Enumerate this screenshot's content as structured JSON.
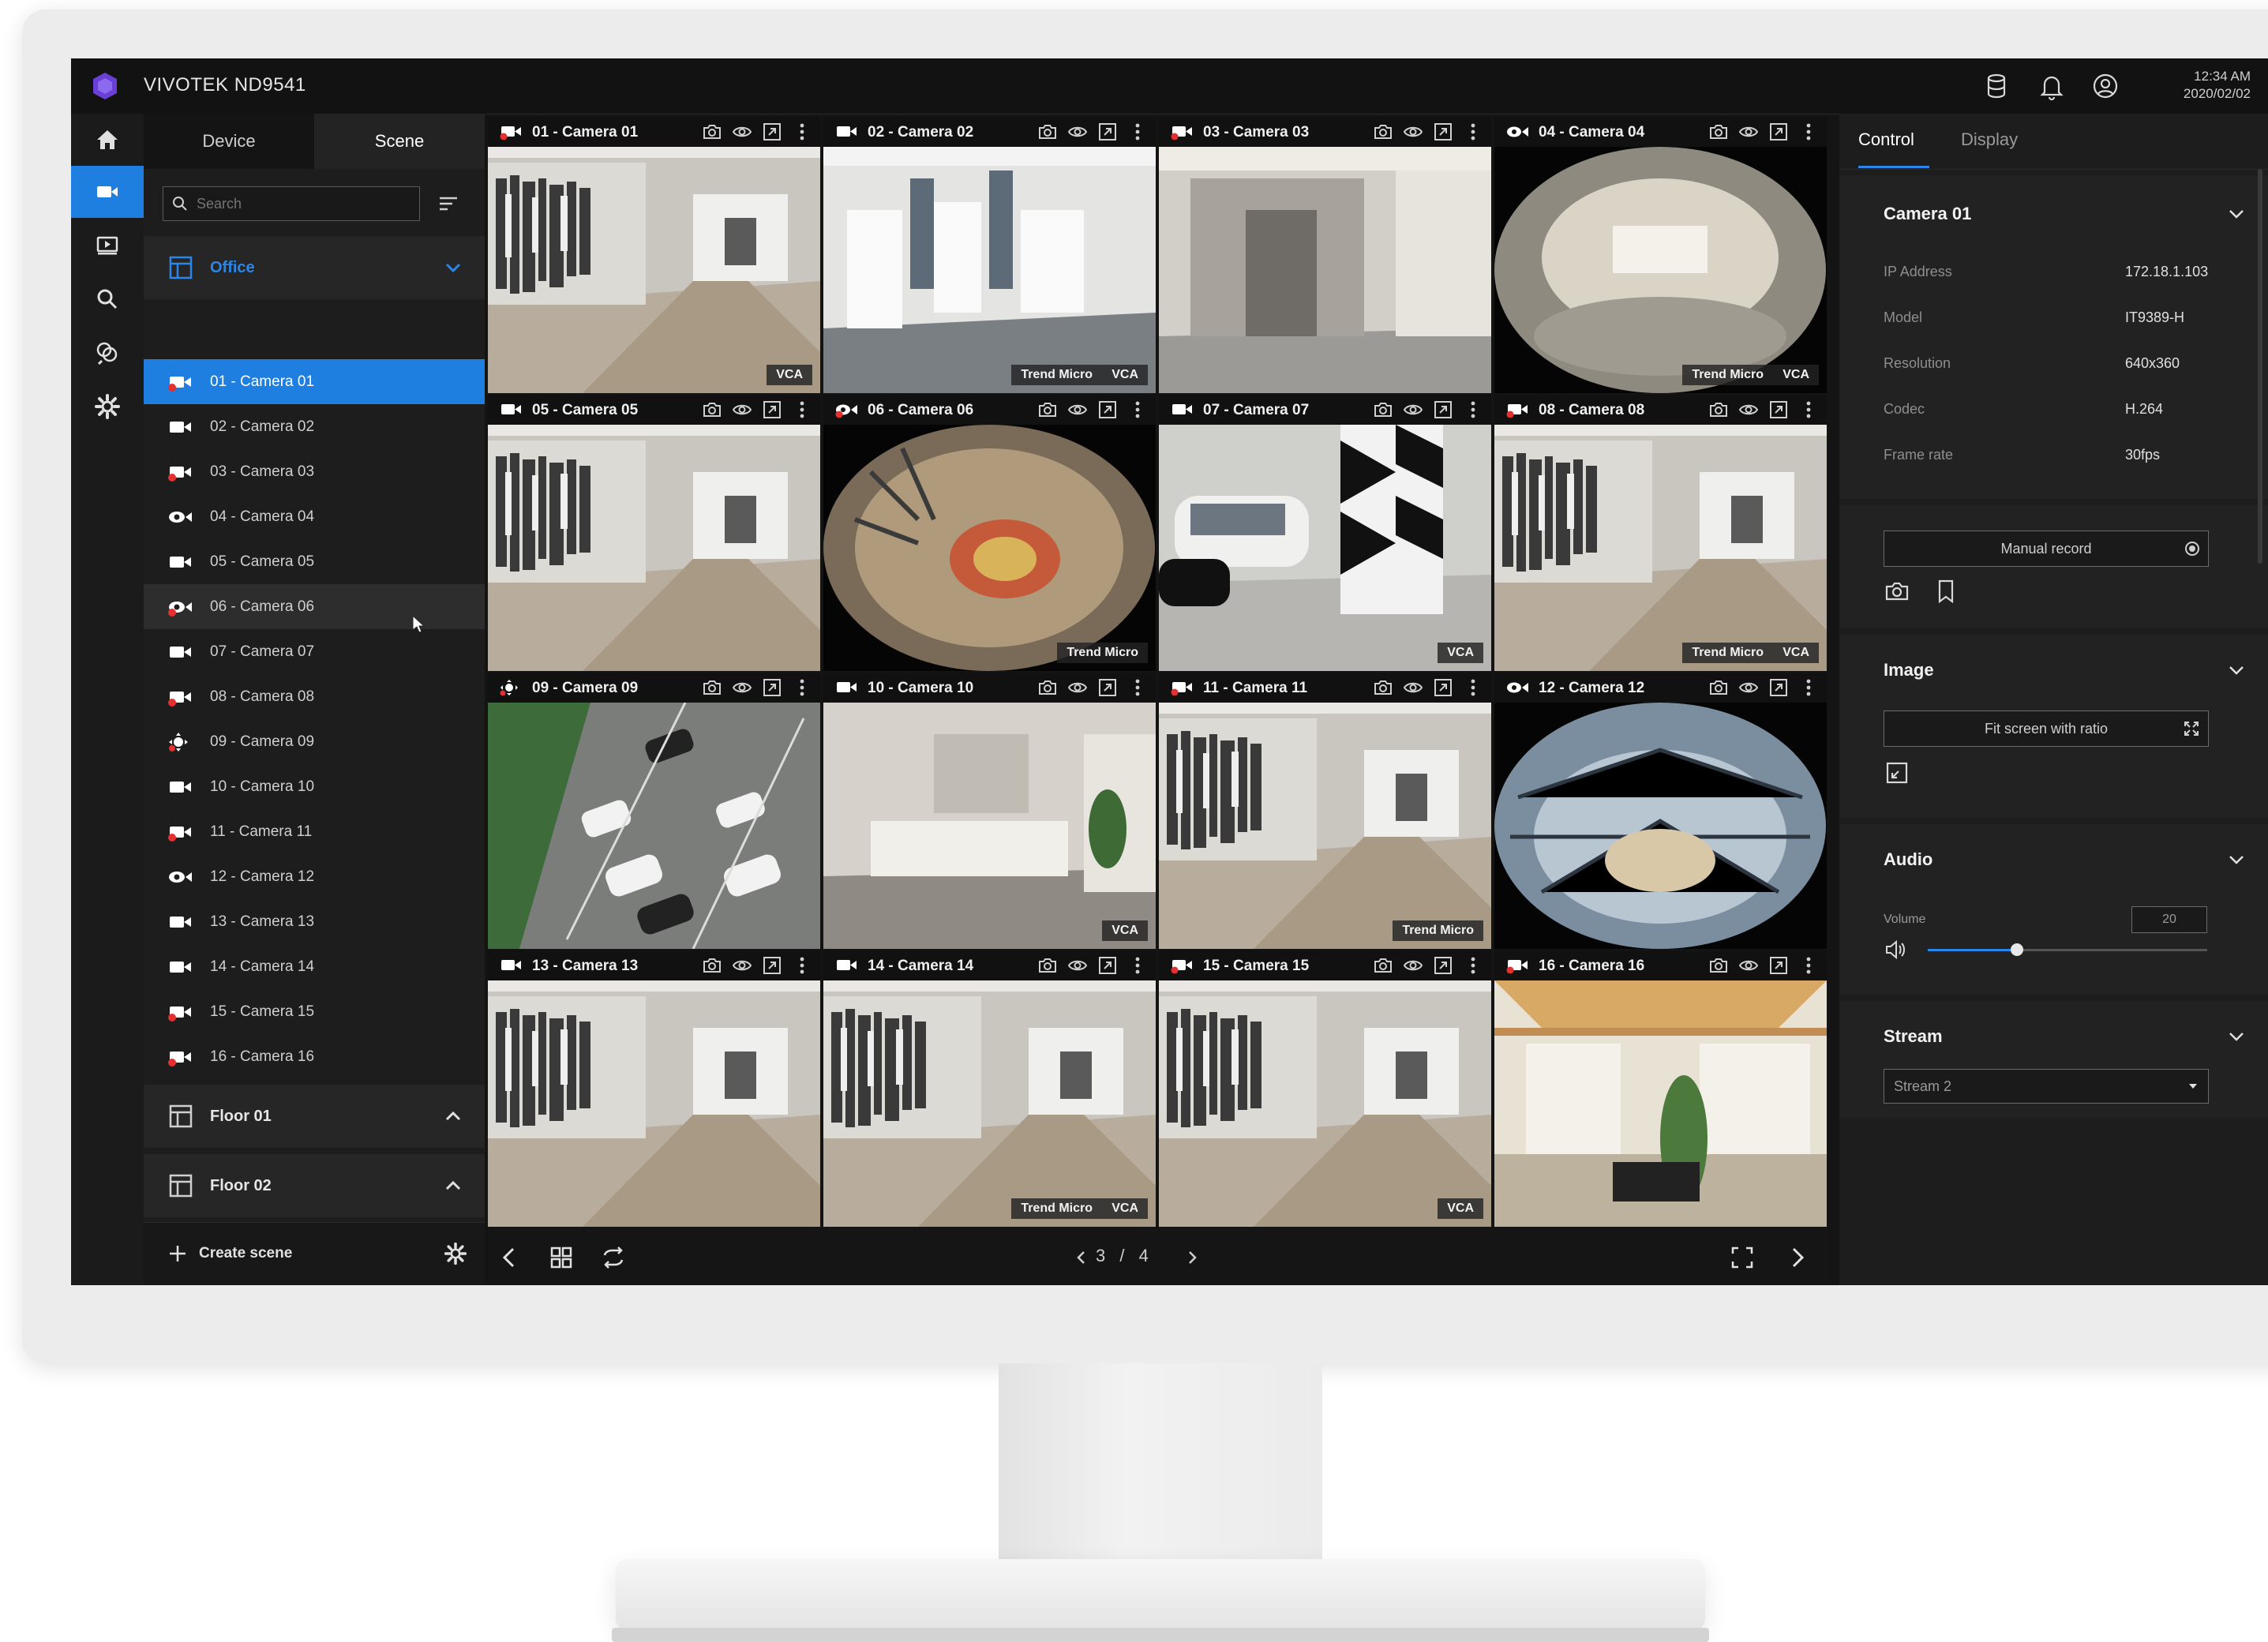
{
  "app": {
    "title": "VIVOTEK ND9541",
    "time": "12:34 AM",
    "date": "2020/02/02"
  },
  "panel": {
    "tabs": [
      "Device",
      "Scene"
    ],
    "search_placeholder": "Search",
    "groups": [
      {
        "label": "Office",
        "expanded": true
      },
      {
        "label": "Floor 01",
        "expanded": false
      },
      {
        "label": "Floor 02",
        "expanded": false
      }
    ],
    "cameras": [
      {
        "label": "01 - Camera 01",
        "icon": "camera-recording-icon"
      },
      {
        "label": "02 - Camera 02",
        "icon": "camera-icon"
      },
      {
        "label": "03 - Camera 03",
        "icon": "camera-recording-icon"
      },
      {
        "label": "04 - Camera 04",
        "icon": "fisheye-camera-icon"
      },
      {
        "label": "05 - Camera 05",
        "icon": "camera-icon"
      },
      {
        "label": "06 - Camera 06",
        "icon": "fisheye-camera-recording-icon"
      },
      {
        "label": "07 - Camera 07",
        "icon": "camera-icon"
      },
      {
        "label": "08 - Camera 08",
        "icon": "camera-recording-icon"
      },
      {
        "label": "09 - Camera 09",
        "icon": "ptz-camera-icon"
      },
      {
        "label": "10 - Camera 10",
        "icon": "camera-icon"
      },
      {
        "label": "11 - Camera 11",
        "icon": "camera-recording-icon"
      },
      {
        "label": "12 - Camera 12",
        "icon": "fisheye-camera-icon"
      },
      {
        "label": "13 - Camera 13",
        "icon": "camera-icon"
      },
      {
        "label": "14 - Camera 14",
        "icon": "camera-icon"
      },
      {
        "label": "15 - Camera 15",
        "icon": "camera-recording-icon"
      },
      {
        "label": "16 - Camera 16",
        "icon": "camera-recording-icon"
      }
    ],
    "create_label": "Create scene"
  },
  "tiles": [
    {
      "name": "01 - Camera 01",
      "badges": [
        "VCA"
      ],
      "scene": "store"
    },
    {
      "name": "02 - Camera 02",
      "badges": [
        "Trend Micro",
        "VCA"
      ],
      "scene": "office"
    },
    {
      "name": "03 - Camera 03",
      "badges": [],
      "scene": "corridor"
    },
    {
      "name": "04 - Camera 04",
      "badges": [
        "Trend Micro",
        "VCA"
      ],
      "scene": "fisheye"
    },
    {
      "name": "05 - Camera 05",
      "badges": [],
      "scene": "store"
    },
    {
      "name": "06 - Camera 06",
      "badges": [
        "Trend Micro"
      ],
      "scene": "fisheye-top"
    },
    {
      "name": "07 - Camera 07",
      "badges": [
        "VCA"
      ],
      "scene": "parking"
    },
    {
      "name": "08 - Camera 08",
      "badges": [
        "Trend Micro",
        "VCA"
      ],
      "scene": "store"
    },
    {
      "name": "09 - Camera 09",
      "badges": [],
      "scene": "lot"
    },
    {
      "name": "10 - Camera 10",
      "badges": [
        "VCA"
      ],
      "scene": "lobby"
    },
    {
      "name": "11 - Camera 11",
      "badges": [
        "Trend Micro"
      ],
      "scene": "store"
    },
    {
      "name": "12 - Camera 12",
      "badges": [],
      "scene": "fisheye-bright"
    },
    {
      "name": "13 - Camera 13",
      "badges": [],
      "scene": "store"
    },
    {
      "name": "14 - Camera 14",
      "badges": [
        "Trend Micro",
        "VCA"
      ],
      "scene": "store"
    },
    {
      "name": "15 - Camera 15",
      "badges": [
        "VCA"
      ],
      "scene": "store"
    },
    {
      "name": "16 - Camera 16",
      "badges": [],
      "scene": "room"
    }
  ],
  "pager": {
    "current": "3",
    "total": "4"
  },
  "right": {
    "tabs": [
      "Control",
      "Display"
    ],
    "camera": {
      "title": "Camera 01",
      "fields": [
        {
          "label": "IP Address",
          "value": "172.18.1.103"
        },
        {
          "label": "Model",
          "value": "IT9389-H"
        },
        {
          "label": "Resolution",
          "value": "640x360"
        },
        {
          "label": "Codec",
          "value": "H.264"
        },
        {
          "label": "Frame rate",
          "value": "30fps"
        }
      ]
    },
    "manual_record": "Manual record",
    "image": {
      "title": "Image",
      "fit_label": "Fit screen with ratio"
    },
    "audio": {
      "title": "Audio",
      "volume_label": "Volume",
      "volume_value": "20",
      "volume_fraction": 0.32
    },
    "stream": {
      "title": "Stream",
      "selected": "Stream 2"
    }
  },
  "colors": {
    "accent": "#1f7fe0",
    "background": "#141414",
    "record": "#e53030"
  }
}
